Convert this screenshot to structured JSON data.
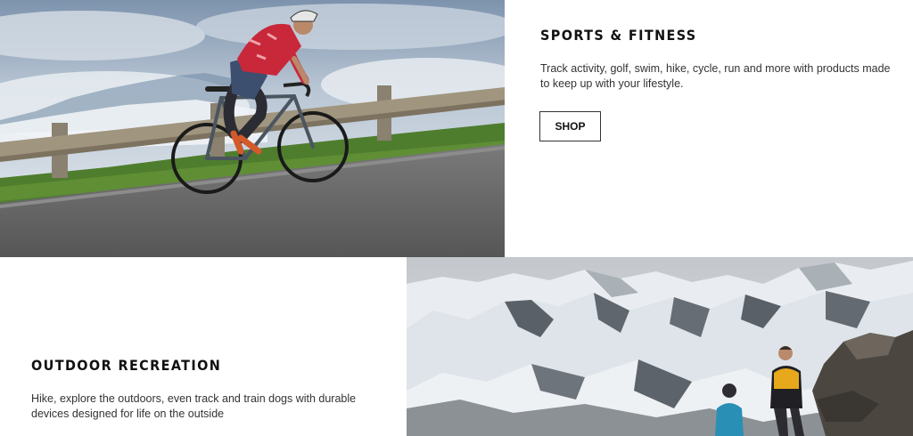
{
  "sports_fitness": {
    "title": "SPORTS & FITNESS",
    "description": "Track activity, golf, swim, hike, cycle, run and more with products made to keep up with your lifestyle.",
    "shop_label": "SHOP"
  },
  "outdoor_recreation": {
    "title": "OUTDOOR RECREATION",
    "description": "Hike, explore the outdoors, even track and train dogs with durable devices designed for life on the outside"
  },
  "colors": {
    "jersey": "#c8283a",
    "sky": "#9fb3c8",
    "road": "#6b6b6b",
    "grass": "#4f7d2e",
    "snow": "#e8ecf0",
    "rock": "#4a4f55",
    "hiker_jacket_yellow": "#e8a81c",
    "hiker_jacket_blue": "#2a8fb5"
  }
}
